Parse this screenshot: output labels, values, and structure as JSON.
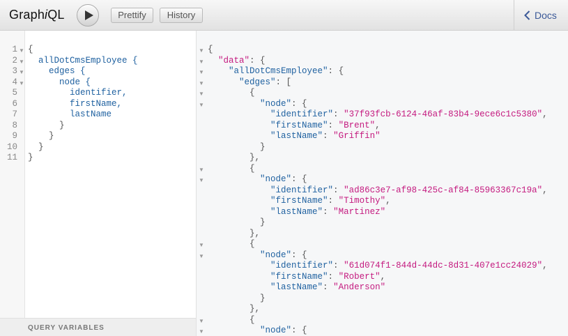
{
  "app": {
    "title_prefix": "Graph",
    "title_italic": "i",
    "title_suffix": "QL"
  },
  "toolbar": {
    "prettify_label": "Prettify",
    "history_label": "History",
    "docs_label": "Docs"
  },
  "query_editor": {
    "line_numbers": [
      "1",
      "2",
      "3",
      "4",
      "5",
      "6",
      "7",
      "8",
      "9",
      "10",
      "11"
    ],
    "lines": [
      "{",
      "  allDotCmsEmployee {",
      "    edges {",
      "      node {",
      "        identifier,",
      "        firstName,",
      "        lastName",
      "      }",
      "    }",
      "  }",
      "}"
    ],
    "variables_label": "QUERY VARIABLES"
  },
  "result": {
    "lines": [
      "{",
      "  \"data\": {",
      "    \"allDotCmsEmployee\": {",
      "      \"edges\": [",
      "        {",
      "          \"node\": {",
      "            \"identifier\": \"37f93fcb-6124-46af-83b4-9ece6c1c5380\",",
      "            \"firstName\": \"Brent\",",
      "            \"lastName\": \"Griffin\"",
      "          }",
      "        },",
      "        {",
      "          \"node\": {",
      "            \"identifier\": \"ad86c3e7-af98-425c-af84-85963367c19a\",",
      "            \"firstName\": \"Timothy\",",
      "            \"lastName\": \"Martinez\"",
      "          }",
      "        },",
      "        {",
      "          \"node\": {",
      "            \"identifier\": \"61d074f1-844d-44dc-8d31-407e1cc24029\",",
      "            \"firstName\": \"Robert\",",
      "            \"lastName\": \"Anderson\"",
      "          }",
      "        },",
      "        {",
      "          \"node\": {"
    ]
  },
  "colors": {
    "key": "#1f61a0",
    "string": "#c41a7f",
    "punctuation": "#555555",
    "docs_link": "#3b5998"
  },
  "icons": {
    "execute": "play-icon",
    "docs": "chevron-left-icon",
    "fold": "fold-arrow-icon"
  }
}
